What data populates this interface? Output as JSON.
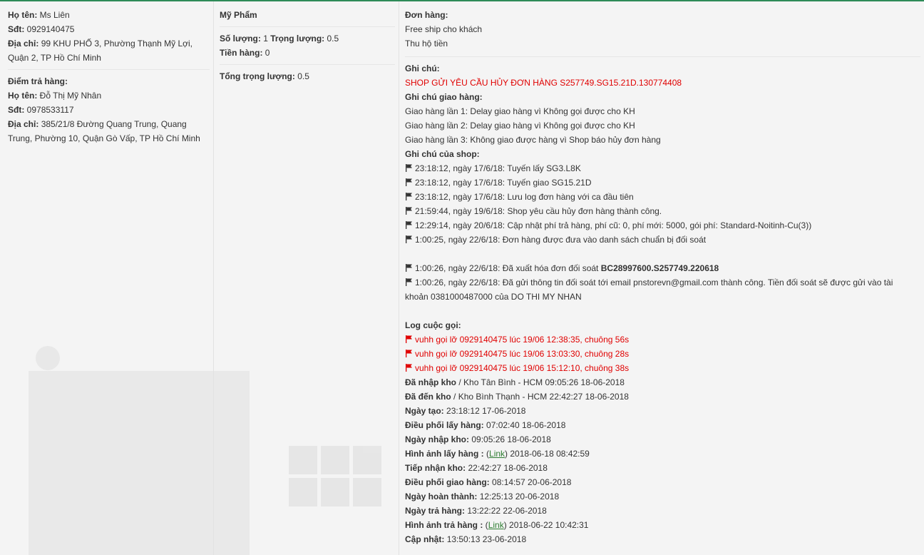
{
  "sender": {
    "name_label": "Họ tên:",
    "name": "Ms Liên",
    "phone_label": "Sđt:",
    "phone": "0929140475",
    "address_label": "Địa chỉ:",
    "address": "99 KHU PHỐ 3, Phường Thạnh Mỹ Lợi, Quận 2, TP Hồ Chí Minh"
  },
  "dropoff": {
    "heading": "Điểm trả hàng:",
    "name_label": "Họ tên:",
    "name": "Đỗ Thị Mỹ Nhân",
    "phone_label": "Sđt:",
    "phone": "0978533117",
    "address_label": "Địa chỉ:",
    "address": "385/21/8 Đường Quang Trung, Quang Trung, Phường 10, Quận Gò Vấp, TP Hồ Chí Minh"
  },
  "product": {
    "name": "Mỹ Phẩm",
    "qty_label": "Số lượng:",
    "qty": "1",
    "weight_label": "Trọng lượng:",
    "weight": "0.5",
    "price_label": "Tiền hàng:",
    "price": "0",
    "total_weight_label": "Tổng trọng lượng:",
    "total_weight": "0.5"
  },
  "order": {
    "heading": "Đơn hàng:",
    "line1": "Free ship cho khách",
    "line2": "Thu hộ tiền",
    "note_heading": "Ghi chú:",
    "note": "SHOP GỬI YÊU CẦU HỦY ĐƠN HÀNG S257749.SG15.21D.130774408",
    "delivery_heading": "Ghi chú giao hàng:",
    "delivery_notes": [
      "Giao hàng lần 1: Delay giao hàng vì Không gọi được cho KH",
      "Giao hàng lần 2: Delay giao hàng vì Không gọi được cho KH",
      "Giao hàng lần 3: Không giao được hàng vì Shop báo hủy đơn hàng"
    ],
    "shop_heading": "Ghi chú của shop:",
    "shop_notes": [
      "23:18:12, ngày 17/6/18: Tuyến lấy SG3.L8K",
      "23:18:12, ngày 17/6/18: Tuyến giao SG15.21D",
      "23:18:12, ngày 17/6/18: Lưu log đơn hàng với ca đầu tiên",
      "21:59:44, ngày 19/6/18: Shop yêu cầu hủy đơn hàng thành công.",
      "12:29:14, ngày 20/6/18: Cập nhật phí trả hàng, phí cũ: 0, phí mới: 5000, gói phí: Standard-Noitinh-Cu(3))",
      "1:00:25, ngày 22/6/18: Đơn hàng được đưa vào danh sách chuẩn bị đối soát"
    ],
    "invoice_prefix": "1:00:26, ngày 22/6/18: Đã xuất hóa đơn đối soát ",
    "invoice_code": "BC28997600.S257749.220618",
    "recon_text": "1:00:26, ngày 22/6/18: Đã gửi thông tin đối soát tới email pnstorevn@gmail.com thành công. Tiền đối soát sẽ được gửi vào tài khoản 0381000487000 của DO THI MY NHAN",
    "call_heading": "Log cuộc gọi:",
    "calls": [
      "vuhh gọi lỡ 0929140475 lúc 19/06 12:38:35, chuông 56s",
      "vuhh gọi lỡ 0929140475 lúc 19/06 13:03:30, chuông 28s",
      "vuhh gọi lỡ 0929140475 lúc 19/06 15:12:10, chuông 38s"
    ],
    "status": {
      "import_label": "Đã nhập kho",
      "import_value": " / Kho Tân Bình - HCM 09:05:26 18-06-2018",
      "arrive_label": "Đã đến kho",
      "arrive_value": " / Kho Bình Thạnh - HCM 22:42:27 18-06-2018",
      "created_label": "Ngày tạo:",
      "created": "23:18:12 17-06-2018",
      "pickup_dispatch_label": "Điều phối lấy hàng:",
      "pickup_dispatch": "07:02:40 18-06-2018",
      "warehouse_in_label": "Ngày nhập kho:",
      "warehouse_in": "09:05:26 18-06-2018",
      "pickup_img_label": "Hình ảnh lấy hàng :",
      "pickup_img_link": "Link",
      "pickup_img_time": "2018-06-18 08:42:59",
      "received_label": "Tiếp nhận kho:",
      "received": "22:42:27 18-06-2018",
      "delivery_dispatch_label": "Điều phối giao hàng:",
      "delivery_dispatch": "08:14:57 20-06-2018",
      "done_label": "Ngày hoàn thành:",
      "done": "12:25:13 20-06-2018",
      "return_label": "Ngày trả hàng:",
      "return": "13:22:22 22-06-2018",
      "return_img_label": "Hình ảnh trả hàng :",
      "return_img_link": "Link",
      "return_img_time": "2018-06-22 10:42:31",
      "updated_label": "Cập nhật:",
      "updated": "13:50:13 23-06-2018"
    }
  },
  "colors": {
    "accent": "#2e8b57",
    "alert": "#e00000",
    "link": "#2e7d32"
  },
  "icons": {
    "flag": "flag-icon",
    "red_flag": "red-flag-icon"
  }
}
